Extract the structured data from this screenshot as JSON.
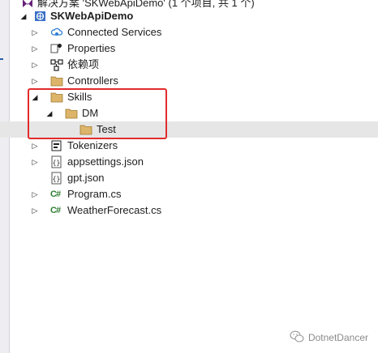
{
  "header": {
    "solution_label": "解决方案 'SKWebApiDemo' (1 个项目, 共 1 个)"
  },
  "tree": {
    "project": "SKWebApiDemo",
    "items": {
      "connected_services": "Connected Services",
      "properties": "Properties",
      "dependencies": "依赖项",
      "controllers": "Controllers",
      "skills": "Skills",
      "dm": "DM",
      "test": "Test",
      "tokenizers": "Tokenizers",
      "appsettings": "appsettings.json",
      "gpt": "gpt.json",
      "program": "Program.cs",
      "weather": "WeatherForecast.cs"
    }
  },
  "icons": {
    "expanded": "▲ (rotated, filled triangle)",
    "collapsed": "▷",
    "folder": "folder-icon",
    "csharp": "C#"
  },
  "watermark": {
    "text": "DotnetDancer"
  },
  "colors": {
    "highlight_box": "#e32b2b",
    "selected_row": "#e6e6e6",
    "folder": "#dcb56a",
    "csharp": "#2e7d32"
  }
}
